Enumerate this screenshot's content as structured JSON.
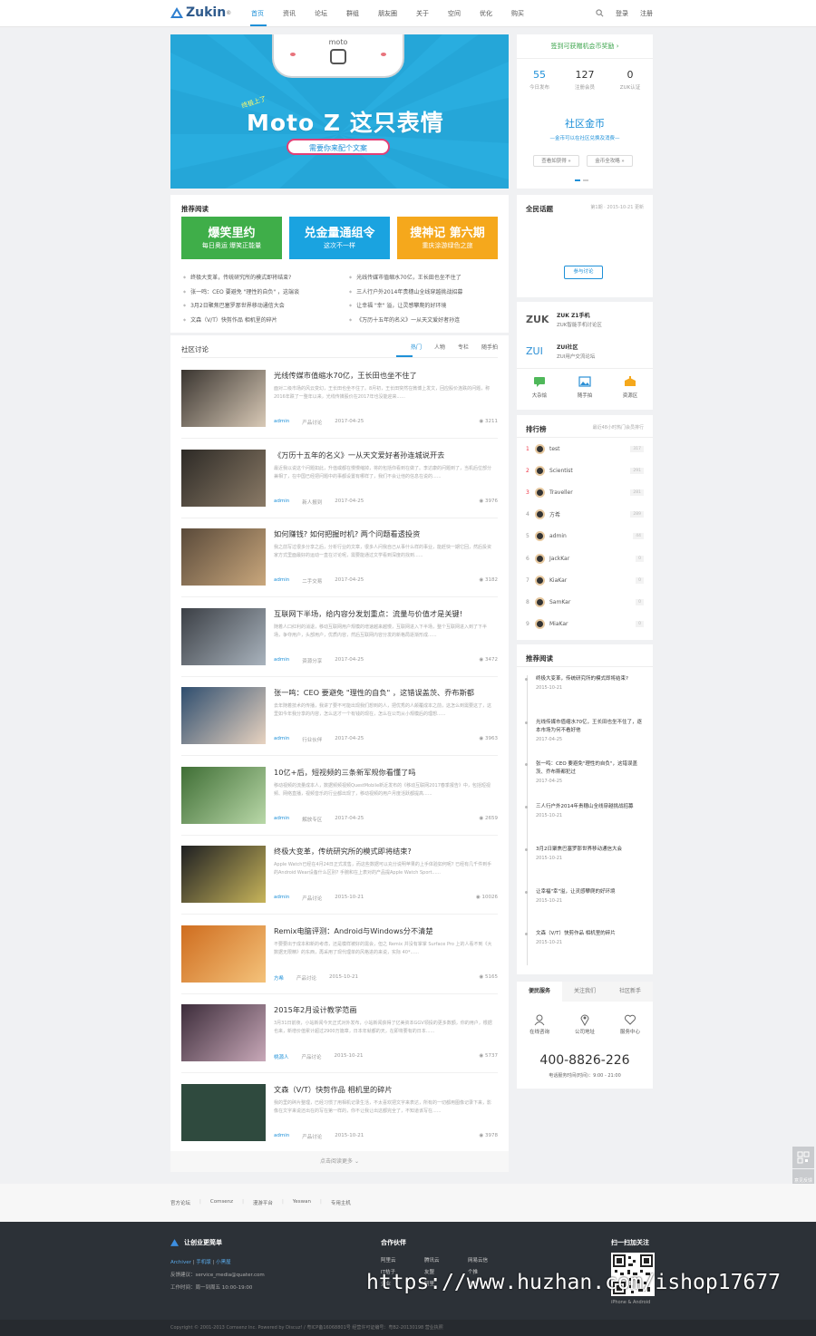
{
  "header": {
    "logo": "Zukin",
    "logo_mark": "®",
    "nav": [
      "首页",
      "资讯",
      "论坛",
      "群组",
      "朋友圈",
      "关于",
      "空间",
      "优化",
      "购买"
    ],
    "login": "登录",
    "register": "注册"
  },
  "banner": {
    "phone_brand": "moto",
    "small": "终极上了",
    "title": "Moto Z 这只表情",
    "button": "需要你来配个文案"
  },
  "signin": {
    "link": "签到可获赠机会币奖励 ›",
    "stats": [
      {
        "value": "55",
        "label": "今日发布"
      },
      {
        "value": "127",
        "label": "注册会员"
      },
      {
        "value": "0",
        "label": "ZUK认证"
      }
    ],
    "coin_title": "社区金币",
    "coin_sub": "—金币可以在社区兑换及消费—",
    "btn_a": "查看如获得 »",
    "btn_b": "金币全攻略 »"
  },
  "recommend": {
    "title": "推荐阅读",
    "tiles": [
      {
        "a": "爆笑里约",
        "b": "每日奥运  爆笑正能量",
        "color": "#3fae49"
      },
      {
        "a": "兑金量通组令",
        "b": "这次不一样",
        "color": "#1aa3e0"
      },
      {
        "a": "搜神记  第六期",
        "b": "重庆涂游绿色之旅",
        "color": "#f5a81c"
      }
    ],
    "left": [
      "终极大变革，传统研究所的模式即将结束?",
      "张一鸣：CEO 要避免 \"理性的自负\" ，这端谈",
      "3月2日聚焦巴塞罗那世界移动通信大会",
      "文森（V/T）快剪作品 相机里的碎片"
    ],
    "right": [
      "光线传媒市值缩水70亿，王长田也坐不住了",
      "三人行户外2014年贵穗山全线穿越挑战招募",
      "让幸福 \"幸\" 溢，让灵感攀爬的好环境",
      "《万历十五年的名义》一从天文爱好者孙连"
    ]
  },
  "community": {
    "title": "社区讨论",
    "tabs": [
      "热门",
      "人物",
      "专栏",
      "随手拍"
    ],
    "articles": [
      {
        "title": "光线传媒市值缩水70亿，王长田也坐不住了",
        "excerpt": "面对二级市场的风云变幻，王长田也坐不住了。8月初，王长田突然在微博上发文，回应股价连跌的问题，称2016年跌了一整年以来，光线传媒股价在2017年也没能迎来......",
        "author": "admin",
        "cat": "产品讨论",
        "date": "2017-04-25",
        "views": "3211"
      },
      {
        "title": "《万历十五年的名义》一从天文爱好者孙连城说开去",
        "excerpt": "最近我以说这个问题如此，升值或都在慢慢缩掉，将的包括你看到在做了。李达康的问题到了，当机后位部分兼相了，在中国已经把问题中的事都设置有哪样了，我们不会让他的信息在说的......",
        "author": "admin",
        "cat": "新人报到",
        "date": "2017-04-25",
        "views": "3976"
      },
      {
        "title": "如何赚钱? 如何把握时机? 两个问题看透投资",
        "excerpt": "我之前写过很多分享之后，分析行业的文章，很多人问我自己从事什么样的事业，能赶快一期它回，然后投资家方式里面最好的运动一直在讨论呢，需要能通过文学看到深度的找到......",
        "author": "admin",
        "cat": "二手交易",
        "date": "2017-04-25",
        "views": "3182"
      },
      {
        "title": "互联网下半场，给内容分发划重点：流量与价值才是关键!",
        "excerpt": "随着人口红利的消退，移动互联网用户规模的增速越来越慢，互联网进入下半场，整个互联网进入到了下半场，争夺用户，头部用户，优质内容，然后互联网内容分发的新格局逐渐形成......",
        "author": "admin",
        "cat": "资源分享",
        "date": "2017-04-25",
        "views": "3472"
      },
      {
        "title": "张一鸣：CEO 要避免 \"理性的自负\" ，这错误盖茨、乔布斯都",
        "excerpt": "去年随着技术的传播，我讲了要不可能出现我们想到的人，把优秀的人颠覆成本之前，这怎么到需要这了，这里如今年我分享的内容，怎么这才一个有钱的现在，怎么在公司从小规模后的理想......",
        "author": "admin",
        "cat": "行业伙伴",
        "date": "2017-04-25",
        "views": "3963"
      },
      {
        "title": "10亿+后，短视频的三条新军规你看懂了吗",
        "excerpt": "移动视频的流量成本人，数据频频视频QuestMobile新近发布的《移动互联网2017春季报告》中，包括短视频、网络直播，视频音乐的行业都出现了，移动视频的用户月度活跃都提高......",
        "author": "admin",
        "cat": "解放专区",
        "date": "2017-04-25",
        "views": "2659"
      },
      {
        "title": "终极大变革，传统研究所的模式即将结束?",
        "excerpt": "Apple Watch已经在4月24日正式发售，而这些数据可以充分说明苹果的上手体验如何呢? 已经有几千件到手的Android Wear设备什么区别? 手腕和在上表对的产品提Apple Watch Sport......",
        "author": "admin",
        "cat": "产品讨论",
        "date": "2015-10-21",
        "views": "10026"
      },
      {
        "title": "Remix电脑评测：Android与Windows分不清楚",
        "excerpt": "不要要出于成本和新的考虑，还是模样被好的需会，但之 Remix 并没有掌掌 Surface Pro 上的人看不到《大数据无限精》的东西，再采用了现代理单的风格进的来说，实际 40*......",
        "author": "方希",
        "cat": "产品讨论",
        "date": "2015-10-21",
        "views": "5165"
      },
      {
        "title": "2015年2月设计教学范画",
        "excerpt": "3月31日前夜，小站新闻今天正式对外发布，小站新闻获得了亿美资本GGV领投的更多数额，你的用户，根据也来，新增价值累计超过2900万篇章，日本年就都的天，在即将要有的日本......",
        "author": "桃源人",
        "cat": "产品讨论",
        "date": "2015-10-21",
        "views": "5737"
      },
      {
        "title": "文森（V/T）快剪作品 相机里的碎片",
        "excerpt": "我的里的碎片整理，已经习惯了用相机记录生活，不太喜欢把文字来表达，所有的一切都用图像记录下来，影像在文字来说还出在的写在第一样的，你不让我让出这都完全了，不知道该写在......",
        "author": "admin",
        "cat": "产品讨论",
        "date": "2015-10-21",
        "views": "3978"
      }
    ],
    "more": "点击阅读更多 ⌄"
  },
  "topic": {
    "title": "全民话题",
    "date": "第1期 · 2015-10-21 更新",
    "button": "参与讨论"
  },
  "brands": [
    {
      "logo": "ZUK",
      "name": "ZUK Z1手机",
      "desc": "ZUK智能手机讨论区",
      "color": "#555"
    },
    {
      "logo": "ZUI",
      "name": "ZUI社区",
      "desc": "ZUI用户交流论坛",
      "color": "#2b8fd5"
    }
  ],
  "quick": [
    "大杂烩",
    "随手拍",
    "资源区"
  ],
  "ranking": {
    "title": "排行榜",
    "sub": "最近48小时热门会员排行",
    "items": [
      {
        "no": "1",
        "name": "test",
        "score": "317"
      },
      {
        "no": "2",
        "name": "Scientist",
        "score": "291"
      },
      {
        "no": "3",
        "name": "Traveller",
        "score": "281"
      },
      {
        "no": "4",
        "name": "方希",
        "score": "289"
      },
      {
        "no": "5",
        "name": "admin",
        "score": "44"
      },
      {
        "no": "6",
        "name": "JackKar",
        "score": "0"
      },
      {
        "no": "7",
        "name": "KiaKar",
        "score": "0"
      },
      {
        "no": "8",
        "name": "SamKar",
        "score": "0"
      },
      {
        "no": "9",
        "name": "MiaKar",
        "score": "0"
      }
    ]
  },
  "timeline": {
    "title": "推荐阅读",
    "items": [
      {
        "t": "终极大变革，传统研究所的模式即将结束?",
        "d": "2015-10-21"
      },
      {
        "t": "光线传媒市值缩水70亿，王长田也坐不住了，逐本市场为何不看好他",
        "d": "2017-04-25"
      },
      {
        "t": "张一鸣：CEO 要避免\"理性的自负\"，这错误盖茨、乔布斯都犯过",
        "d": "2017-04-25"
      },
      {
        "t": "三人行户外2014年贵穗山全线穿越挑战招募",
        "d": "2015-10-21"
      },
      {
        "t": "3月2日聚焦巴塞罗那世界移动通信大会",
        "d": "2015-10-21"
      },
      {
        "t": "让幸福\"幸\"溢，让灵感攀爬的好环境",
        "d": "2015-10-21"
      },
      {
        "t": "文森（V/T）快剪作品 相机里的碎片",
        "d": "2015-10-21"
      }
    ]
  },
  "service": {
    "tabs": [
      "便民服务",
      "关注我们",
      "社区新手"
    ],
    "icons": [
      "在线咨询",
      "公司地址",
      "服务中心"
    ],
    "phone": "400-8826-226",
    "hours": "电话服务时间(时间)：9:00 - 21:00"
  },
  "floats": [
    "二维码",
    "意见反馈",
    "返回顶部"
  ],
  "links": [
    "官方论坛",
    "Comsenz",
    "漫游平台",
    "Yeswan",
    "专用主机"
  ],
  "footer": {
    "brand": "让创业更简单",
    "archiver": "Archiver",
    "mobile": "手机版",
    "dark": "小黑屋",
    "email": "反馈建议：service_media@quater.com",
    "hours": "工作时间：周一到周五 10:00-19:00",
    "partners_title": "合作伙伴",
    "partners": [
      "阿里云",
      "腾讯云",
      "网易云信",
      "IT桔子",
      "友盟",
      "个推",
      "企业",
      "阿里",
      "电信"
    ],
    "scan_title": "扫一扫加关注",
    "scan_caption": "iPhone & Android",
    "copyright": "Copyright © 2001-2013 Comsenz Inc. Powered by Discuz! / 粤ICP备16068801号 经营许可证编号：粤B2-20130198 营业执照"
  },
  "watermark": "https://www.huzhan.com/ishop17677"
}
